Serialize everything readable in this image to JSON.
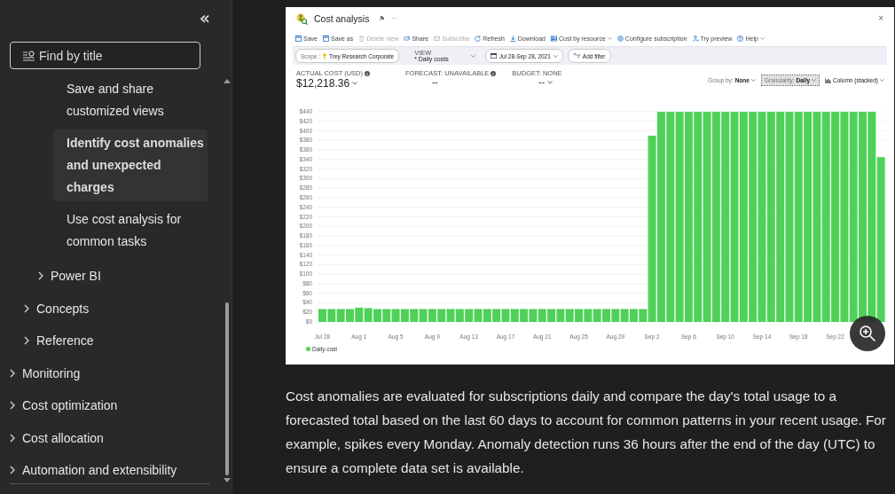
{
  "sidebar": {
    "collapse_button": "«",
    "search": {
      "placeholder": "Find by title"
    },
    "toc": [
      {
        "children": [
          {
            "children": [
              {
                "children": [
                  {
                    "label": "Save and share customized views",
                    "selected": false
                  },
                  {
                    "label": "Identify cost anomalies and unexpected charges",
                    "selected": true
                  },
                  {
                    "label": "Use cost analysis for common tasks",
                    "selected": false
                  }
                ]
              },
              {
                "label": "Power BI",
                "expanded": false
              }
            ]
          },
          {
            "label": "Concepts",
            "expanded": false
          },
          {
            "label": "Reference",
            "expanded": false
          }
        ]
      },
      {
        "label": "Monitoring",
        "expanded": false
      },
      {
        "label": "Cost optimization",
        "expanded": false
      },
      {
        "label": "Cost allocation",
        "expanded": false
      },
      {
        "label": "Automation and extensibility",
        "expanded": false
      }
    ]
  },
  "screenshot": {
    "title": "Cost analysis",
    "more": "···",
    "close": "×",
    "toolbar": [
      {
        "kind": "save",
        "label": "Save",
        "disabled": false,
        "dropdown": false
      },
      {
        "kind": "save-as",
        "label": "Save as",
        "disabled": false,
        "dropdown": false
      },
      {
        "kind": "delete",
        "label": "Delete view",
        "disabled": true,
        "dropdown": false
      },
      {
        "kind": "share",
        "label": "Share",
        "disabled": false,
        "dropdown": false
      },
      {
        "kind": "subscribe",
        "label": "Subscribe",
        "disabled": true,
        "dropdown": false
      },
      {
        "kind": "refresh",
        "label": "Refresh",
        "disabled": false,
        "dropdown": false
      },
      {
        "kind": "download",
        "label": "Download",
        "disabled": false,
        "dropdown": false
      },
      {
        "kind": "table",
        "label": "Cost by resource",
        "disabled": false,
        "dropdown": true
      },
      {
        "kind": "gear",
        "label": "Configure subscription",
        "disabled": false,
        "dropdown": false
      },
      {
        "kind": "preview",
        "label": "Try preview",
        "disabled": false,
        "dropdown": false
      },
      {
        "kind": "help",
        "label": "Help",
        "disabled": false,
        "dropdown": true
      }
    ],
    "scope": {
      "label": "Scope :",
      "value": "Trey Research Corporate"
    },
    "view": {
      "label": "VIEW",
      "value": "* Daily costs"
    },
    "date_range": "Jul 28-Sep 28, 2021",
    "add_filter": "Add filter",
    "metrics": [
      {
        "label": "ACTUAL COST (USD)",
        "value": "$12,218.36",
        "info": true,
        "dropdown": true
      },
      {
        "label": "FORECAST: UNAVAILABLE",
        "value": "--",
        "info": true,
        "dropdown": false
      },
      {
        "label": "BUDGET: NONE",
        "value": "--",
        "info": false,
        "dropdown": true
      }
    ],
    "chart_options": [
      {
        "kind": "option",
        "label": "Group by:",
        "value": "None",
        "selected": false
      },
      {
        "kind": "option",
        "label": "Granularity:",
        "value": "Daily",
        "selected": true
      },
      {
        "kind": "chart-type",
        "label": "Column (stacked)",
        "selected": false
      }
    ],
    "chart_data": {
      "type": "bar",
      "grid": true,
      "categories": [
        "Jul 28",
        null,
        null,
        null,
        "Aug 1",
        null,
        null,
        null,
        "Aug 5",
        null,
        null,
        null,
        "Aug 9",
        null,
        null,
        null,
        "Aug 13",
        null,
        null,
        null,
        "Aug 17",
        null,
        null,
        null,
        "Aug 21",
        null,
        null,
        null,
        "Aug 25",
        null,
        null,
        null,
        "Aug 29",
        null,
        null,
        null,
        "Sep 2",
        null,
        null,
        null,
        "Sep 6",
        null,
        null,
        null,
        "Sep 10",
        null,
        null,
        null,
        "Sep 14",
        null,
        null,
        null,
        "Sep 18",
        null,
        null,
        null,
        "Sep 22",
        null,
        null,
        null,
        null,
        null
      ],
      "series": [
        {
          "name": "Daily cost",
          "color": "#4fd157",
          "values": [
            27,
            27,
            27,
            27,
            30,
            29,
            27,
            27,
            27,
            27,
            27,
            27,
            27,
            27,
            27,
            27,
            27,
            27,
            27,
            27,
            27,
            27,
            27,
            27,
            27,
            27,
            27,
            27,
            27,
            27,
            27,
            27,
            27,
            27,
            27,
            27,
            390,
            440,
            440,
            440,
            440,
            440,
            440,
            440,
            440,
            440,
            440,
            440,
            440,
            440,
            440,
            440,
            440,
            440,
            440,
            440,
            440,
            440,
            440,
            440,
            440,
            345
          ]
        }
      ],
      "ylim": [
        0,
        440
      ],
      "yticks": [
        {
          "value": 0,
          "label": "$0"
        },
        {
          "value": 20,
          "label": "$20"
        },
        {
          "value": 40,
          "label": "$40"
        },
        {
          "value": 60,
          "label": "$60"
        },
        {
          "value": 80,
          "label": "$80"
        },
        {
          "value": 100,
          "label": "$100"
        },
        {
          "value": 120,
          "label": "$120"
        },
        {
          "value": 140,
          "label": "$140"
        },
        {
          "value": 160,
          "label": "$160"
        },
        {
          "value": 180,
          "label": "$180"
        },
        {
          "value": 200,
          "label": "$200"
        },
        {
          "value": 220,
          "label": "$220"
        },
        {
          "value": 240,
          "label": "$240"
        },
        {
          "value": 260,
          "label": "$260"
        },
        {
          "value": 280,
          "label": "$280"
        },
        {
          "value": 300,
          "label": "$300"
        },
        {
          "value": 320,
          "label": "$320"
        },
        {
          "value": 340,
          "label": "$340"
        },
        {
          "value": 360,
          "label": "$360"
        },
        {
          "value": 380,
          "label": "$380"
        },
        {
          "value": 400,
          "label": "$400"
        },
        {
          "value": 420,
          "label": "$420"
        },
        {
          "value": 440,
          "label": "$440"
        }
      ]
    }
  },
  "paragraph": "Cost anomalies are evaluated for subscriptions daily and compare the day's total usage to a forecasted total based on the last 60 days to account for common patterns in your recent usage. For example, spikes every Monday. Anomaly detection runs 36 hours after the end of the day (UTC) to ensure a complete data set is available."
}
